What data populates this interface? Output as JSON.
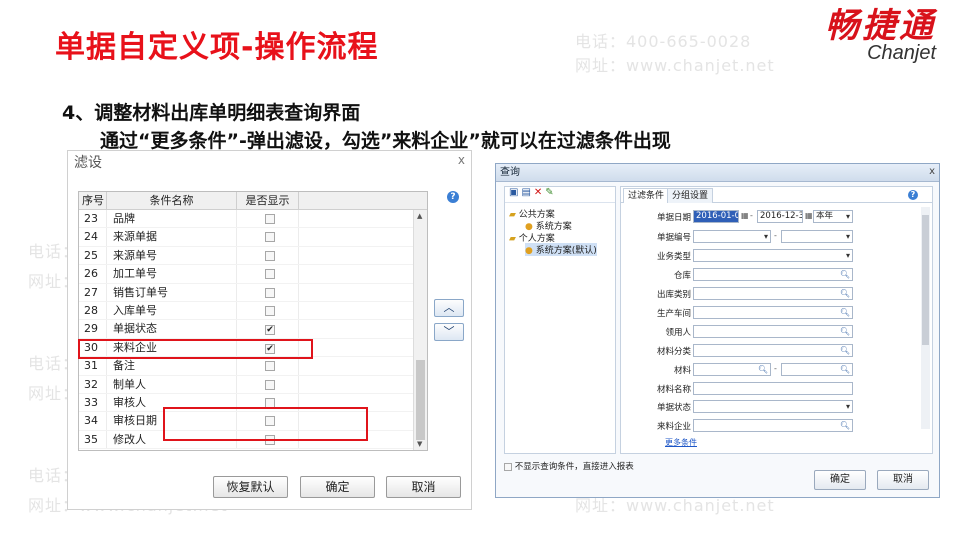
{
  "slide": {
    "title": "单据自定义项-操作流程",
    "logo_cn": "畅捷通",
    "logo_en": "Chanjet",
    "step_title": "4、调整材料出库单明细表查询界面",
    "description": "通过“更多条件”-弹出滤设，勾选”来料企业”就可以在过滤条件出现",
    "watermark_phone": "电话：400-665-0028",
    "watermark_url": "网址：www.chanjet.net"
  },
  "filter_dialog": {
    "title": "滤设",
    "close": "x",
    "help": "?",
    "columns": [
      "序号",
      "条件名称",
      "是否显示"
    ],
    "rows": [
      {
        "no": "23",
        "name": "品牌",
        "checked": false
      },
      {
        "no": "24",
        "name": "来源单据",
        "checked": false
      },
      {
        "no": "25",
        "name": "来源单号",
        "checked": false
      },
      {
        "no": "26",
        "name": "加工单号",
        "checked": false
      },
      {
        "no": "27",
        "name": "销售订单号",
        "checked": false
      },
      {
        "no": "28",
        "name": "入库单号",
        "checked": false
      },
      {
        "no": "29",
        "name": "单据状态",
        "checked": true
      },
      {
        "no": "30",
        "name": "来料企业",
        "checked": true
      },
      {
        "no": "31",
        "name": "备注",
        "checked": false
      },
      {
        "no": "32",
        "name": "制单人",
        "checked": false
      },
      {
        "no": "33",
        "name": "审核人",
        "checked": false
      },
      {
        "no": "34",
        "name": "审核日期",
        "checked": false
      },
      {
        "no": "35",
        "name": "修改人",
        "checked": false
      }
    ],
    "restore_label": "恢复默认",
    "ok_label": "确定",
    "cancel_label": "取消",
    "up_symbol": "︿",
    "down_symbol": "﹀"
  },
  "query_dialog": {
    "title": "查询",
    "close": "x",
    "help": "?",
    "toolbar_icons": [
      "save-icon",
      "save-as-icon",
      "delete-icon",
      "edit-icon"
    ],
    "tree": {
      "public_group": "公共方案",
      "public_scheme": "系统方案",
      "personal_group": "个人方案",
      "personal_scheme": "系统方案(默认)"
    },
    "tabs": [
      "过滤条件",
      "分组设置"
    ],
    "fields": {
      "date_label": "单据日期",
      "date_from": "2016-01-01",
      "date_to": "2016-12-31",
      "date_period": "本年",
      "docno_label": "单据编号",
      "biztype_label": "业务类型",
      "warehouse_label": "仓库",
      "outtype_label": "出库类别",
      "workshop_label": "生产车间",
      "receiver_label": "领用人",
      "category_label": "材料分类",
      "material_label": "材料",
      "material_name_label": "材料名称",
      "status_label": "单据状态",
      "supplier_label": "来料企业"
    },
    "dash": "-",
    "more_conditions": "更多条件",
    "skip_label": "不显示查询条件，直接进入报表",
    "ok_label": "确定",
    "cancel_label": "取消"
  },
  "colors": {
    "title_red": "#e8111a",
    "highlight_red": "#e0141b",
    "link_blue": "#1d56c7"
  }
}
